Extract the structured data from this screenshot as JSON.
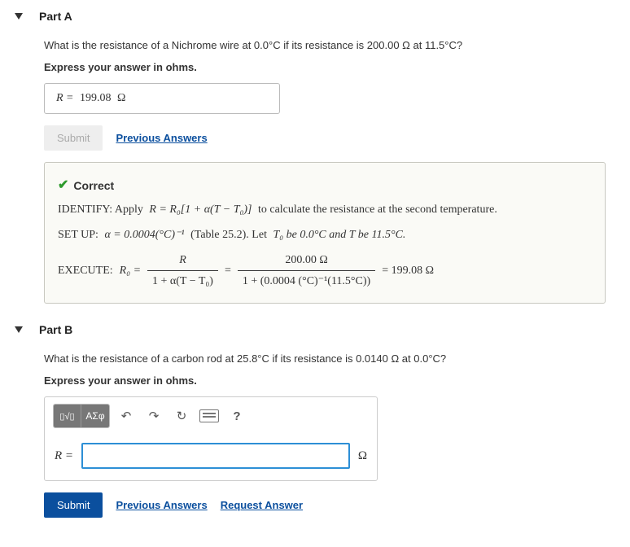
{
  "partA": {
    "title": "Part A",
    "question": "What is the resistance of a Nichrome wire at 0.0°C if its resistance is 200.00 Ω at 11.5°C?",
    "instruction": "Express your answer in ohms.",
    "answer_prefix": "R =",
    "answer_value": "199.08",
    "answer_unit": "Ω",
    "submit_label": "Submit",
    "prev_answers_label": "Previous Answers",
    "feedback": {
      "status": "Correct",
      "identify_label": "IDENTIFY: Apply",
      "identify_formula": "R = R₀[1 + α(T − T₀)]",
      "identify_tail": "to calculate the resistance at the second temperature.",
      "setup_label": "SET UP:",
      "setup_alpha": "α = 0.0004(°C)⁻¹",
      "setup_table": "(Table 25.2). Let",
      "setup_t0": "T₀ be 0.0°C and T be 11.5°C.",
      "execute_label": "EXECUTE:",
      "execute_lhs": "R₀ =",
      "frac1_num": "R",
      "frac1_den": "1 + α(T − T₀)",
      "frac2_num": "200.00 Ω",
      "frac2_den": "1 + (0.0004 (°C)⁻¹(11.5°C))",
      "execute_result": "= 199.08 Ω"
    }
  },
  "partB": {
    "title": "Part B",
    "question": "What is the resistance of a carbon rod at 25.8°C if its resistance is 0.0140 Ω at 0.0°C?",
    "instruction": "Express your answer in ohms.",
    "toolbar": {
      "template_label": "▯√▯",
      "symbols_label": "ΑΣφ",
      "undo_title": "undo",
      "redo_title": "redo",
      "reset_title": "reset",
      "keyboard_title": "keyboard",
      "help_label": "?"
    },
    "input_prefix": "R =",
    "input_unit": "Ω",
    "submit_label": "Submit",
    "prev_answers_label": "Previous Answers",
    "request_answer_label": "Request Answer"
  }
}
